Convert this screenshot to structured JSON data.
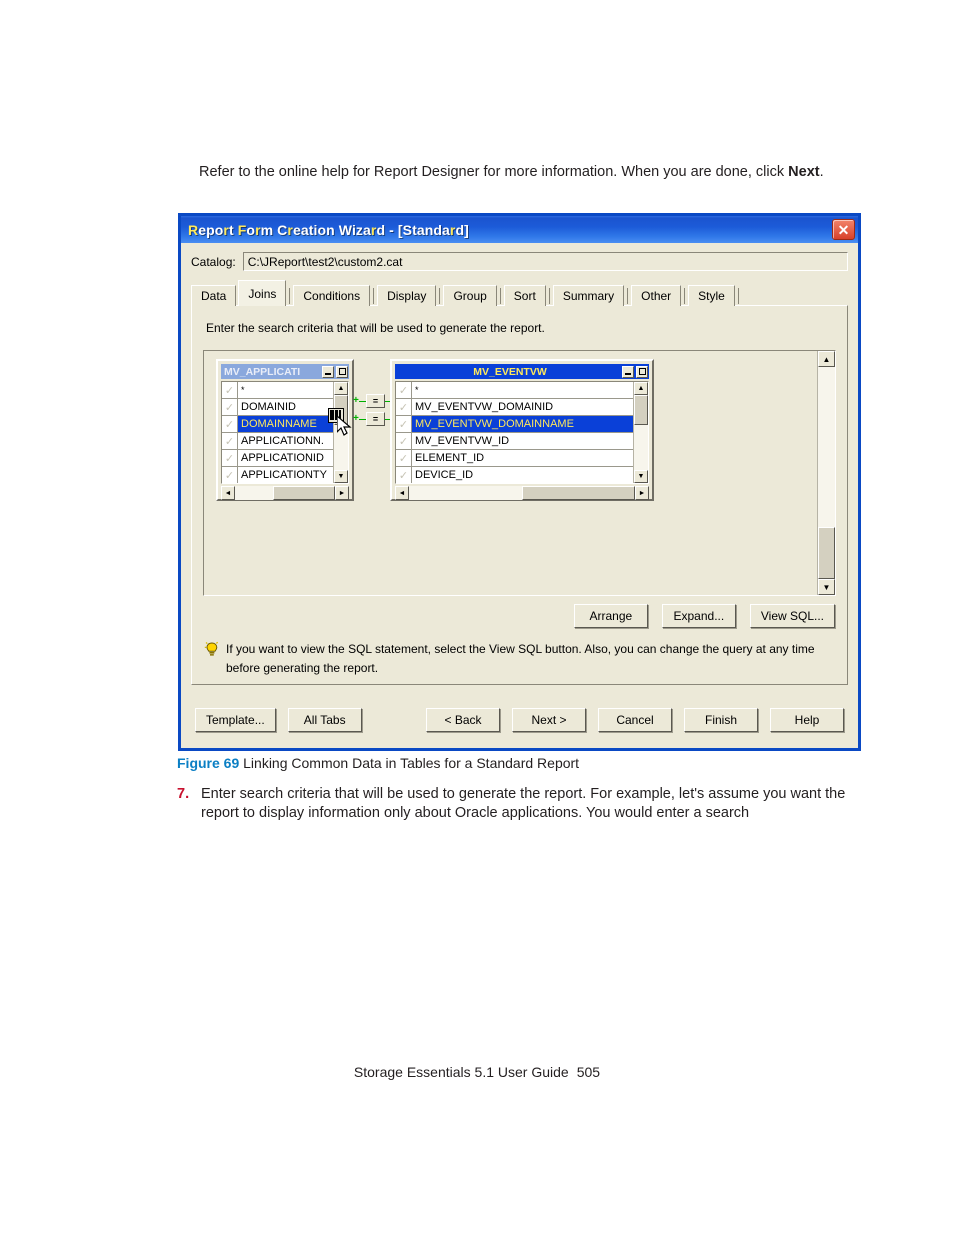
{
  "page": {
    "intro_text": "Refer to the online help for Report Designer for more information. When you are done, click ",
    "intro_bold": "Next",
    "intro_tail": ".",
    "figure_number": "Figure 69",
    "figure_title": "Linking Common Data in Tables for a Standard Report",
    "step_number": "7.",
    "step_text": "Enter search criteria that will be used to generate the report. For example, let's assume you want the report to display information only about Oracle applications. You would enter a search",
    "footer_title": "Storage Essentials 5.1 User Guide",
    "footer_page": "505"
  },
  "dialog": {
    "title_part1": "Report Form Creation Wizard - [Standard]",
    "title_prefix": "R",
    "close_icon": "close-icon",
    "close_glyph": "✕",
    "catalog_label": "Catalog:",
    "catalog_value": "C:\\JReport\\test2\\custom2.cat",
    "tabs": [
      {
        "label": "Data",
        "active": false
      },
      {
        "label": "Joins",
        "active": true
      },
      {
        "label": "Conditions",
        "active": false
      },
      {
        "label": "Display",
        "active": false
      },
      {
        "label": "Group",
        "active": false
      },
      {
        "label": "Sort",
        "active": false
      },
      {
        "label": "Summary",
        "active": false
      },
      {
        "label": "Other",
        "active": false
      },
      {
        "label": "Style",
        "active": false
      }
    ],
    "panel_instruction": "Enter the search criteria that will be used to generate the report.",
    "tables": [
      {
        "name": "MV_APPLICATI",
        "active": false,
        "minimize_label": "–",
        "maximize_label": "□",
        "columns": [
          {
            "label": "*",
            "selected": false,
            "checked": true
          },
          {
            "label": "DOMAINID",
            "selected": false,
            "checked": true
          },
          {
            "label": "DOMAINNAME",
            "selected": true,
            "checked": true
          },
          {
            "label": "APPLICATIONN.",
            "selected": false,
            "checked": true
          },
          {
            "label": "APPLICATIONID",
            "selected": false,
            "checked": true
          },
          {
            "label": "APPLICATIONTY",
            "selected": false,
            "checked": true
          }
        ]
      },
      {
        "name": "MV_EVENTVW",
        "active": true,
        "minimize_label": "–",
        "maximize_label": "□",
        "columns": [
          {
            "label": "*",
            "selected": false,
            "checked": true
          },
          {
            "label": "MV_EVENTVW_DOMAINID",
            "selected": false,
            "checked": true
          },
          {
            "label": "MV_EVENTVW_DOMAINNAME",
            "selected": true,
            "checked": true
          },
          {
            "label": "MV_EVENTVW_ID",
            "selected": false,
            "checked": true
          },
          {
            "label": "ELEMENT_ID",
            "selected": false,
            "checked": true
          },
          {
            "label": "DEVICE_ID",
            "selected": false,
            "checked": true
          }
        ]
      }
    ],
    "joins": [
      {
        "operator": "=",
        "label": "join-equals"
      },
      {
        "operator": "=",
        "label": "join-equals"
      }
    ],
    "panel_buttons": [
      {
        "label": "Arrange"
      },
      {
        "label": "Expand..."
      },
      {
        "label": "View SQL..."
      }
    ],
    "tip_icon": "lightbulb-icon",
    "tip_text": "If you want to view the SQL statement, select the View SQL button.  Also, you can change the query at any time before generating the report.",
    "footer_buttons_left": [
      {
        "label": "Template..."
      },
      {
        "label": "All Tabs"
      }
    ],
    "footer_buttons_right": [
      {
        "label": "< Back"
      },
      {
        "label": "Next >"
      },
      {
        "label": "Cancel"
      },
      {
        "label": "Finish"
      },
      {
        "label": "Help"
      }
    ],
    "scroll_arrows": {
      "up": "▲",
      "down": "▼",
      "left": "◄",
      "right": "►"
    }
  },
  "colors": {
    "titlebar_blue": "#1b54cf",
    "dialog_border": "#0a49c4",
    "dialog_face": "#ece9d8",
    "selection_blue": "#0a40d8",
    "selection_text": "#ffe95c",
    "inactive_title": "#8aa8dd",
    "join_green": "#00b000",
    "figure_label": "#0b7fc4",
    "step_number": "#c8102e"
  }
}
